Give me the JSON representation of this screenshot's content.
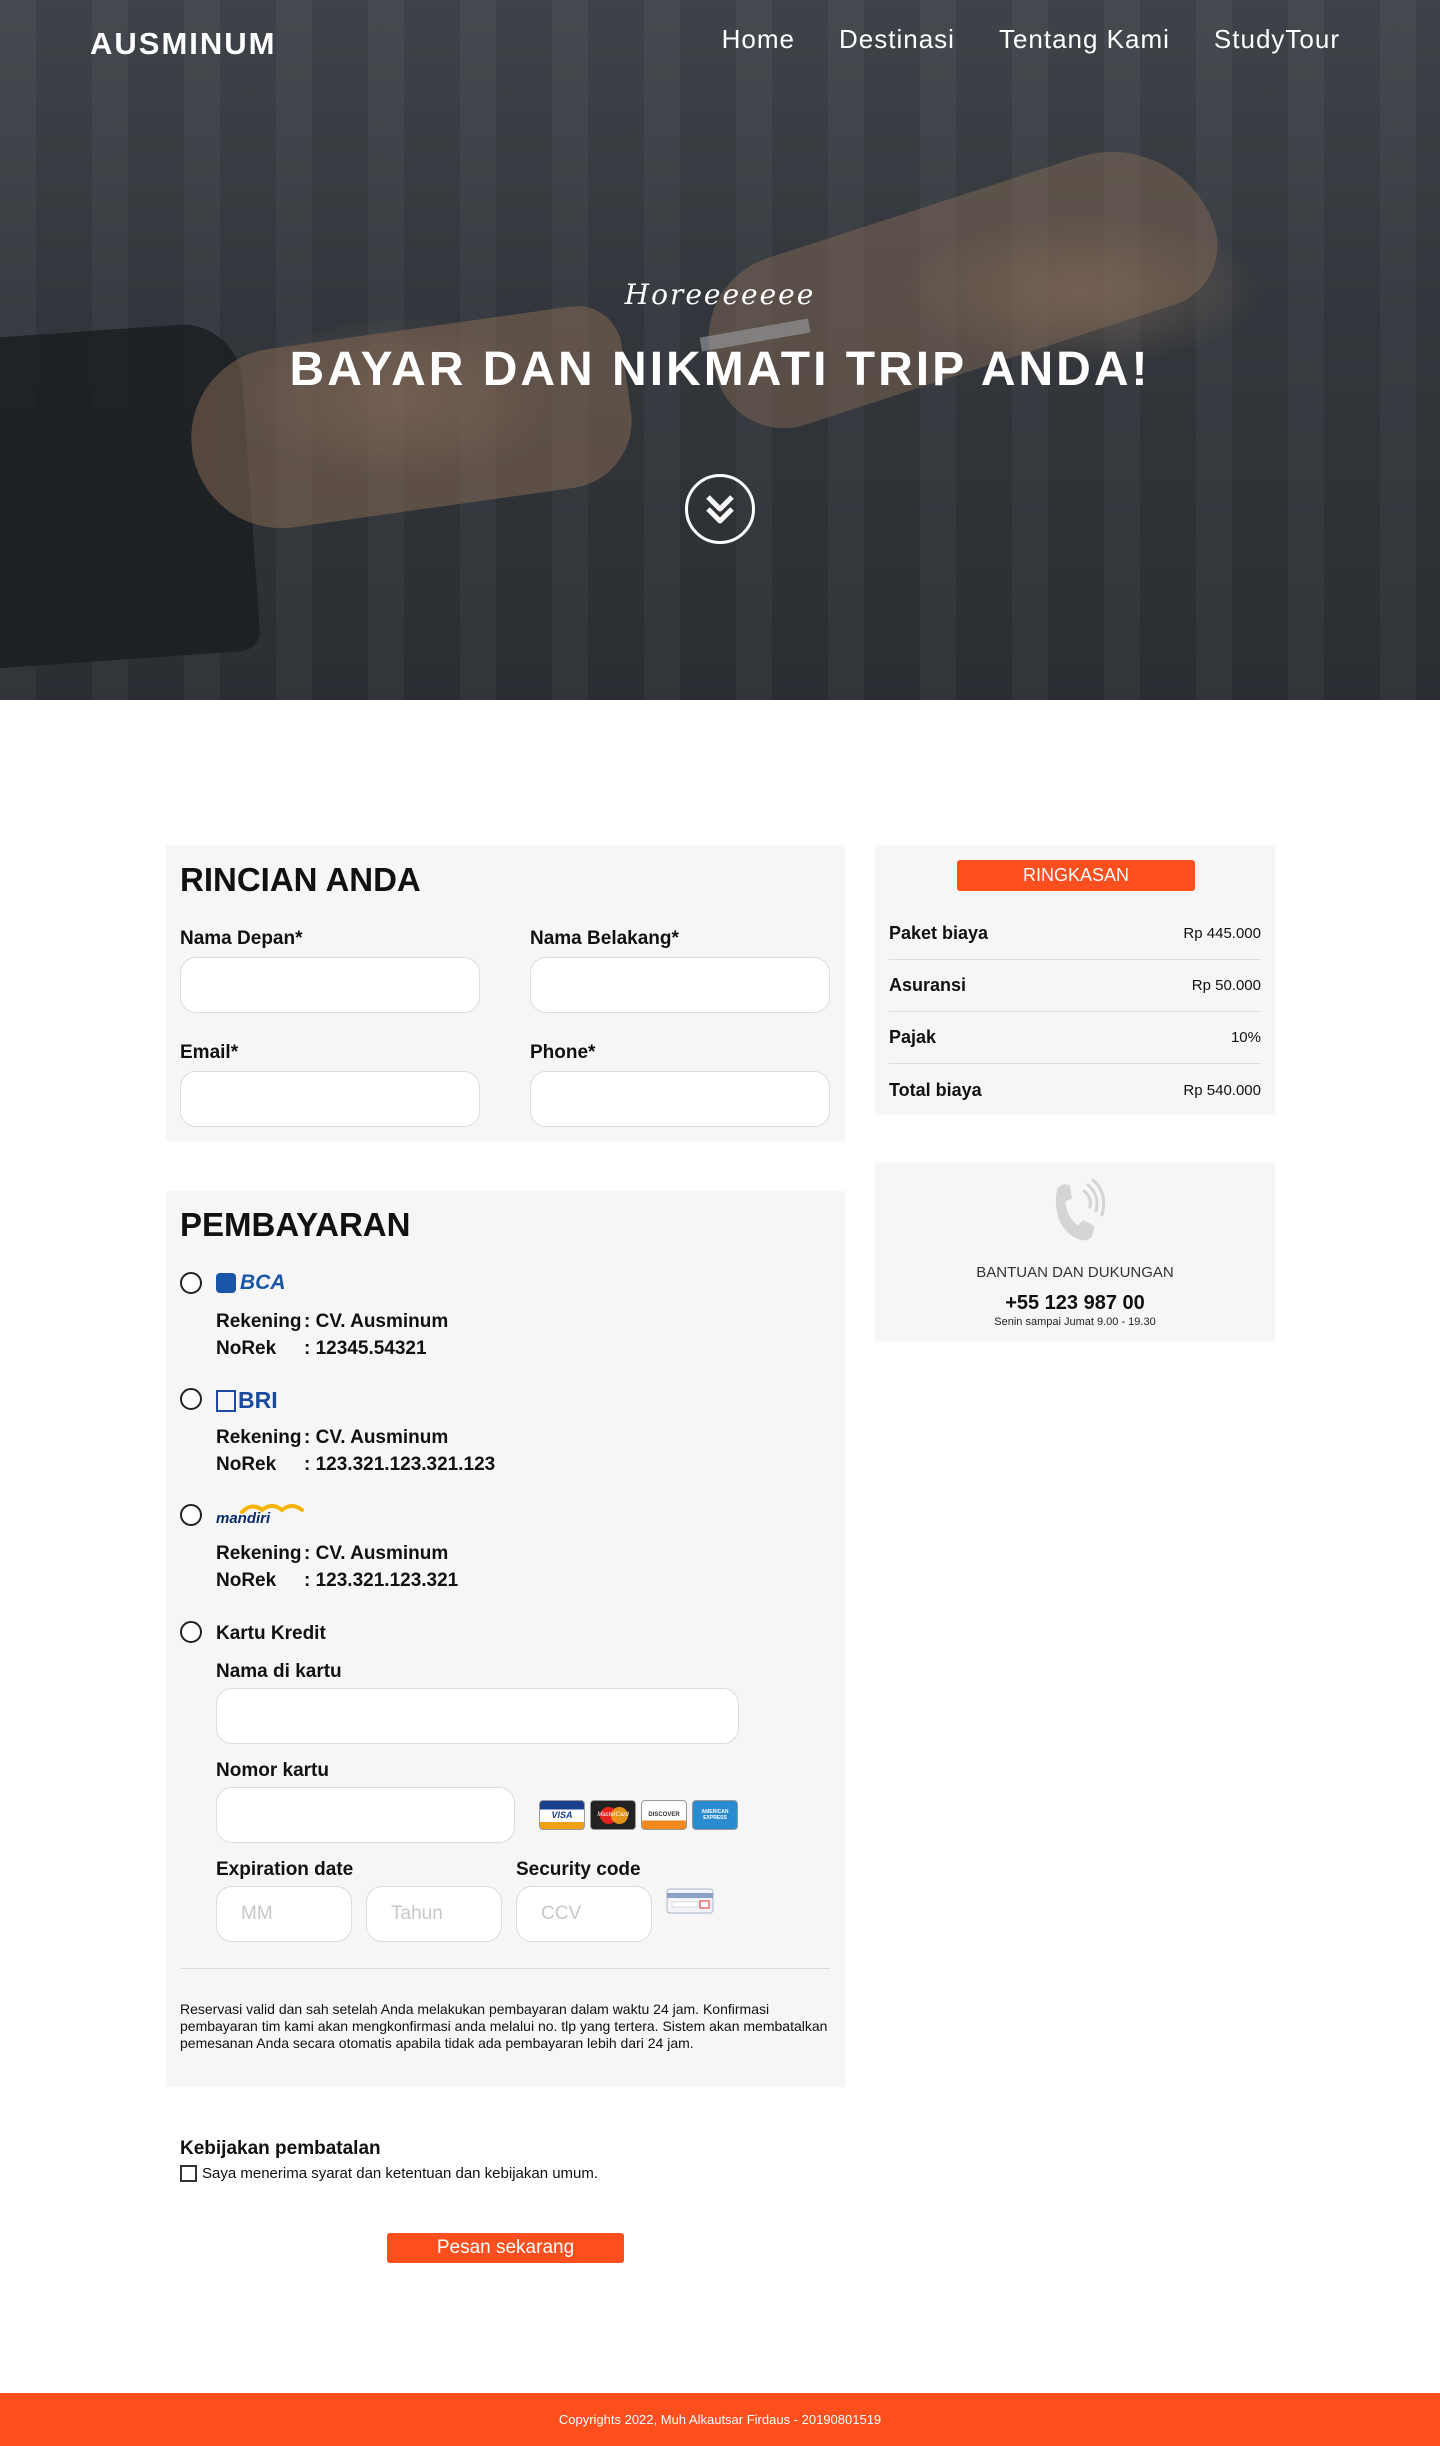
{
  "header": {
    "brand": "AUSMINUM",
    "nav": [
      "Home",
      "Destinasi",
      "Tentang Kami",
      "StudyTour"
    ]
  },
  "hero": {
    "tagline": "Horeeeeeee",
    "headline": "BAYAR DAN NIKMATI TRIP ANDA!"
  },
  "details": {
    "title": "RINCIAN ANDA",
    "first_name_label": "Nama Depan*",
    "last_name_label": "Nama Belakang*",
    "email_label": "Email*",
    "phone_label": "Phone*"
  },
  "payment": {
    "title": "PEMBAYARAN",
    "banks": [
      {
        "logo": "BCA",
        "account_label": "Rekening",
        "account_name": ": CV. Ausminum",
        "norek_label": "NoRek",
        "norek": ": 12345.54321"
      },
      {
        "logo": "BRI",
        "account_label": "Rekening",
        "account_name": ": CV. Ausminum",
        "norek_label": "NoRek",
        "norek": ": 123.321.123.321.123"
      },
      {
        "logo": "mandiri",
        "account_label": "Rekening",
        "account_name": ": CV. Ausminum",
        "norek_label": "NoRek",
        "norek": ": 123.321.123.321"
      }
    ],
    "credit_card": {
      "label": "Kartu Kredit",
      "name_label": "Nama di kartu",
      "number_label": "Nomor kartu",
      "expiration_label": "Expiration date",
      "security_label": "Security code",
      "mm_placeholder": "MM",
      "year_placeholder": "Tahun",
      "ccv_placeholder": "CCV",
      "card_brands": [
        "VISA",
        "MasterCard",
        "DISCOVER",
        "AMERICAN EXPRESS"
      ]
    },
    "note": "Reservasi valid dan sah setelah Anda melakukan pembayaran dalam waktu 24 jam. Konfirmasi pembayaran tim kami akan mengkonfirmasi anda melalui no. tlp yang tertera. Sistem akan membatalkan pemesanan Anda secara otomatis apabila tidak ada pembayaran lebih dari 24 jam."
  },
  "summary": {
    "button": "RINGKASAN",
    "rows": [
      {
        "label": "Paket biaya",
        "value": "Rp 445.000"
      },
      {
        "label": "Asuransi",
        "value": "Rp 50.000"
      },
      {
        "label": "Pajak",
        "value": "10%"
      },
      {
        "label": "Total biaya",
        "value": "Rp 540.000"
      }
    ]
  },
  "support": {
    "title": "BANTUAN DAN DUKUNGAN",
    "phone": "+55 123 987 00",
    "hours": "Senin sampai Jumat 9.00 - 19.30"
  },
  "cancellation": {
    "title": "Kebijakan pembatalan",
    "agree_text": "Saya menerima syarat dan ketentuan dan kebijakan umum."
  },
  "order_button": "Pesan sekarang",
  "footer": {
    "copyright": "Copyrights 2022, Muh Alkautsar Firdaus - 20190801519"
  },
  "colors": {
    "accent": "#fd4f1e",
    "panel": "#f6f6f6"
  }
}
